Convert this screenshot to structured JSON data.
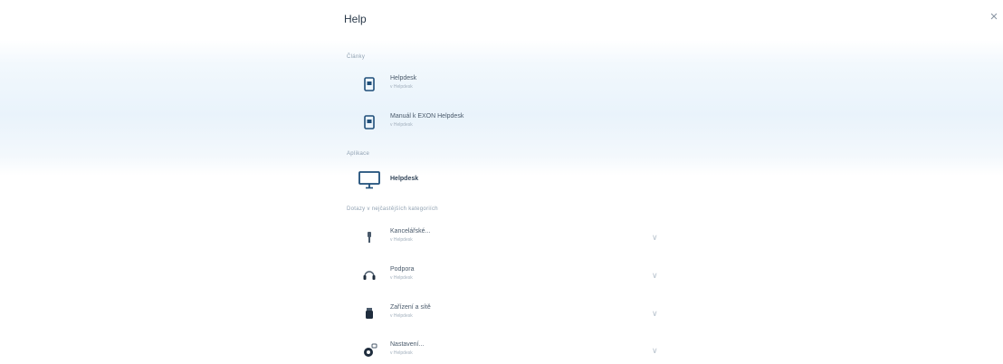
{
  "search": {
    "value": "Help"
  },
  "close_glyph": "×",
  "sections": {
    "pages": {
      "title": "Články",
      "items": [
        {
          "name": "Helpdesk",
          "sub": "v Helpdesk",
          "icon": "document-icon"
        },
        {
          "name": "Manuál k EXON Helpdesk",
          "sub": "v Helpdesk",
          "icon": "document-icon"
        }
      ]
    },
    "apps": {
      "title": "Aplikace",
      "items": [
        {
          "name": "Helpdesk",
          "icon": "monitor-icon"
        }
      ]
    },
    "categories": {
      "title": "Dotazy v nejčastějších kategoriích",
      "items": [
        {
          "name": "Kancelářské...",
          "sub": "v Helpdesk",
          "icon": "lamp-icon"
        },
        {
          "name": "Podpora",
          "sub": "v Helpdesk",
          "icon": "headset-icon"
        },
        {
          "name": "Zařízení a sítě",
          "sub": "v Helpdesk",
          "icon": "device-icon"
        },
        {
          "name": "Nastavení...",
          "sub": "v Helpdesk",
          "icon": "settings-icon"
        }
      ],
      "chevron": "∨"
    }
  },
  "colors": {
    "accent": "#1f4e79",
    "muted": "#8fa0b1",
    "band": "#e9f3fb"
  }
}
